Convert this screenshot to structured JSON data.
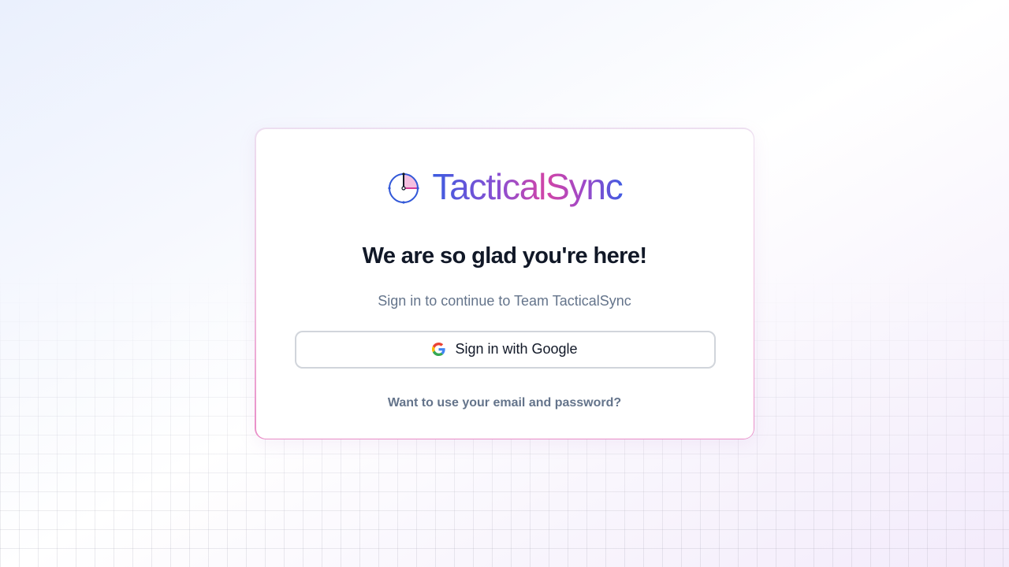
{
  "brand": {
    "name": "TacticalSync",
    "logo_icon": "clock-icon",
    "gradient_colors": [
      "#3c5ce0",
      "#8a4fd2",
      "#d244a6",
      "#3f5be2"
    ]
  },
  "login": {
    "heading": "We are so glad you're here!",
    "subtitle": "Sign in to continue to Team TacticalSync",
    "google_button_label": "Sign in with Google",
    "google_icon": "google-icon",
    "alt_link_text": "Want to use your email and password?"
  },
  "colors": {
    "heading": "#111827",
    "muted_text": "#64748b",
    "card_border_accent": "#e98cc7",
    "button_border": "#d1d5db"
  }
}
